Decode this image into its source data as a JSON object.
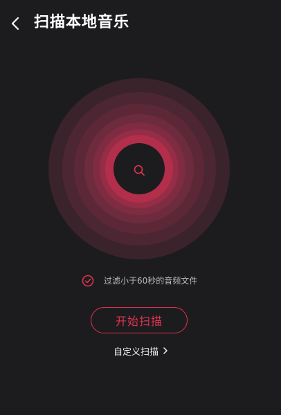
{
  "header": {
    "back_icon": "chevron-left-icon",
    "title": "扫描本地音乐"
  },
  "radar": {
    "center_icon": "search-icon",
    "ring_colors": [
      "#3a232b",
      "#4c2633",
      "#5c2838",
      "#6d2b3e",
      "#7f2c43",
      "#952d47",
      "#b22e4b"
    ],
    "core_color": "#1c1c1f"
  },
  "filter": {
    "checked": true,
    "check_icon": "check-circle-icon",
    "label": "过滤小于60秒的音频文件"
  },
  "actions": {
    "start_label": "开始扫描",
    "custom_label": "自定义扫描",
    "custom_icon": "chevron-right-icon"
  },
  "colors": {
    "accent": "#e0344f",
    "background": "#1c1c1f"
  }
}
